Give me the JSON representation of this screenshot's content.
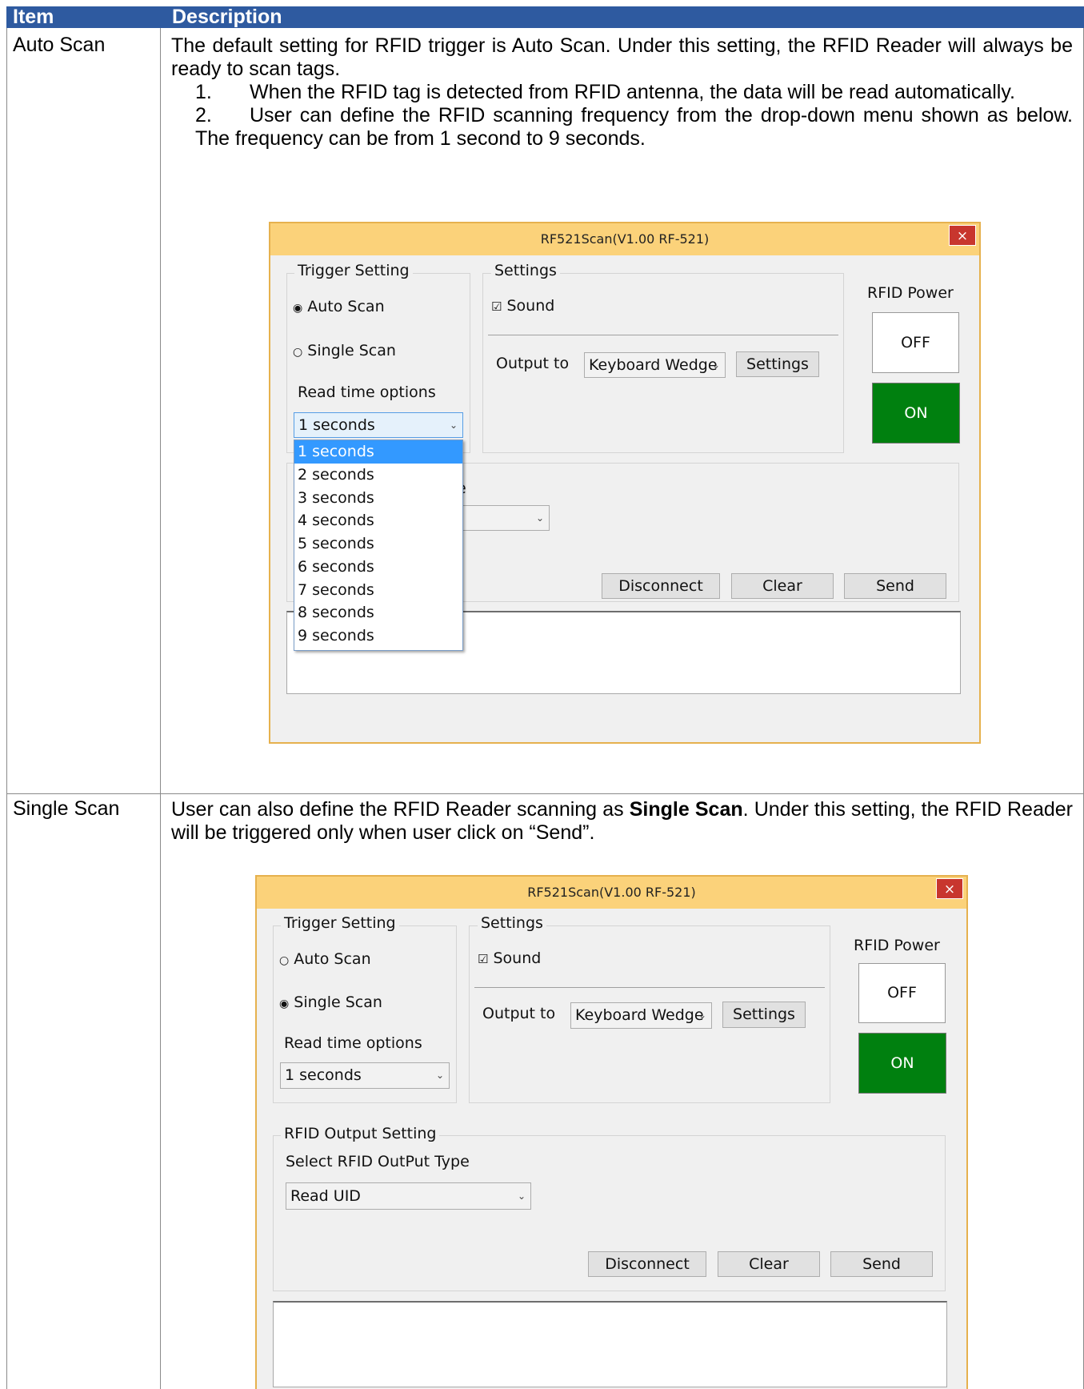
{
  "table": {
    "header": {
      "item": "Item",
      "description": "Description"
    },
    "rows": [
      {
        "item": "Auto Scan",
        "intro": "The default setting for RFID trigger is Auto Scan. Under this setting, the RFID Reader will always be ready to scan tags.",
        "points": [
          {
            "num": "1.",
            "text": "When the RFID tag is detected from RFID antenna, the data will be read automatically."
          },
          {
            "num": "2.",
            "text": "User can define the RFID scanning frequency from the drop-down menu shown as below. The frequency can be from 1 second to 9 seconds."
          }
        ]
      },
      {
        "item": "Single Scan",
        "intro_pre": "User can also define the RFID Reader scanning as ",
        "intro_bold": "Single Scan",
        "intro_post": ". Under this setting, the RFID Reader will be triggered only when user click on “Send”."
      }
    ]
  },
  "window": {
    "title": "RF521Scan(V1.00 RF-521)",
    "close": "×",
    "trigger_group": "Trigger Setting",
    "auto_scan": "Auto Scan",
    "single_scan": "Single Scan",
    "read_time_label": "Read time options",
    "read_time_value": "1 seconds",
    "settings_group": "Settings",
    "sound": "Sound",
    "output_label": "Output to",
    "output_value": "Keyboard Wedge",
    "settings_button": "Settings",
    "power_label": "RFID Power",
    "off": "OFF",
    "on": "ON",
    "output_group": "RFID Output Setting",
    "output_type_label": "Select RFID OutPut Type",
    "output_type_value": "Read UID",
    "output_type_partial": "pe",
    "disconnect": "Disconnect",
    "clear": "Clear",
    "send": "Send",
    "chevron": "⌄",
    "radio_on": "◉",
    "radio_off": "○",
    "check": "☑",
    "options": [
      "1 seconds",
      "2 seconds",
      "3 seconds",
      "4 seconds",
      "5 seconds",
      "6 seconds",
      "7 seconds",
      "8 seconds",
      "9 seconds"
    ]
  },
  "colors": {
    "header": "#2e5aa0",
    "window_border": "#e6b14e",
    "title_bar": "#fbd27a",
    "close": "#c8362e",
    "on_button": "#00800f",
    "highlight": "#3399ff"
  }
}
